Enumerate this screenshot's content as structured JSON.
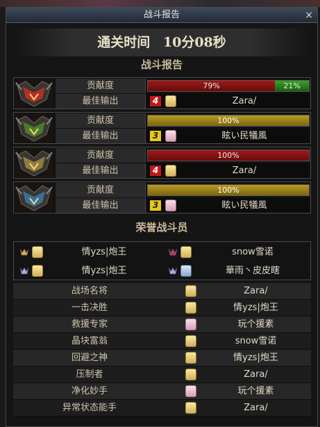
{
  "window": {
    "title": "战斗报告",
    "close_glyph": "×"
  },
  "clear_time": {
    "label": "通关时间",
    "value": "10分08秒"
  },
  "report_heading": "战斗报告",
  "honor_heading": "荣誉战斗员",
  "labels": {
    "contribution": "贡献度",
    "best_output": "最佳输出"
  },
  "cards": [
    {
      "portrait": "flame-demon-portrait",
      "color": "#c83020",
      "segments": [
        {
          "text": "79%",
          "value": 79,
          "style": "red"
        },
        {
          "text": "21%",
          "value": 21,
          "style": "green"
        }
      ],
      "rank": "4",
      "rank_style": "red",
      "face": "blonde",
      "player": "Zara/"
    },
    {
      "portrait": "green-demon-portrait",
      "color": "#4a8a2a",
      "segments": [
        {
          "text": "100%",
          "value": 100,
          "style": "gold"
        }
      ],
      "rank": "3",
      "rank_style": "yellow",
      "face": "pink",
      "player": "眩い民犠風"
    },
    {
      "portrait": "gold-demon-portrait",
      "color": "#a08a40",
      "segments": [
        {
          "text": "100%",
          "value": 100,
          "style": "red"
        }
      ],
      "rank": "4",
      "rank_style": "red",
      "face": "blonde",
      "player": "Zara/"
    },
    {
      "portrait": "blue-demon-portrait",
      "color": "#3a7aa8",
      "segments": [
        {
          "text": "100%",
          "value": 100,
          "style": "gold"
        }
      ],
      "rank": "3",
      "rank_style": "yellow",
      "face": "pink",
      "player": "眩い民犠風"
    }
  ],
  "honor": [
    {
      "name": "情yzs|炮王",
      "face": "blonde",
      "medal": "gold"
    },
    {
      "name": "snow雪诺",
      "face": "blonde",
      "medal": "red"
    },
    {
      "name": "情yzs|炮王",
      "face": "blonde",
      "medal": "silver"
    },
    {
      "name": "華雨丶皮皮瞎",
      "face": "blue",
      "medal": "silver"
    }
  ],
  "awards": [
    {
      "title": "战场名将",
      "player": "Zara/",
      "face": "blonde"
    },
    {
      "title": "一击决胜",
      "player": "情yzs|炮王",
      "face": "blonde"
    },
    {
      "title": "救援专家",
      "player": "玩个援素",
      "face": "pink"
    },
    {
      "title": "晶块富翁",
      "player": "snow雪诺",
      "face": "blonde"
    },
    {
      "title": "回避之神",
      "player": "情yzs|炮王",
      "face": "blonde"
    },
    {
      "title": "压制者",
      "player": "Zara/",
      "face": "blonde"
    },
    {
      "title": "净化妙手",
      "player": "玩个援素",
      "face": "pink"
    },
    {
      "title": "异常状态能手",
      "player": "Zara/",
      "face": "blonde"
    }
  ]
}
